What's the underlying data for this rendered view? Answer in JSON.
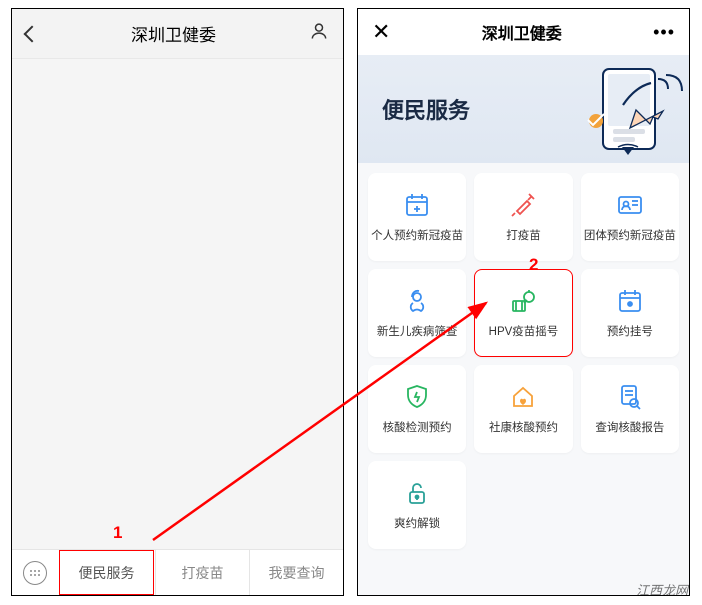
{
  "left": {
    "title": "深圳卫健委",
    "tabs": {
      "t1": "便民服务",
      "t2": "打疫苗",
      "t3": "我要查询"
    }
  },
  "right": {
    "title": "深圳卫健委",
    "banner": "便民服务",
    "cards": {
      "c0": "个人预约新冠疫苗",
      "c1": "打疫苗",
      "c2": "团体预约新冠疫苗",
      "c3": "新生儿疾病筛查",
      "c4": "HPV疫苗摇号",
      "c5": "预约挂号",
      "c6": "核酸检测预约",
      "c7": "社康核酸预约",
      "c8": "查询核酸报告",
      "c9": "爽约解锁"
    }
  },
  "annotations": {
    "a1": "1",
    "a2": "2"
  },
  "colors": {
    "blue": "#3a8ef0",
    "red": "#ef5350",
    "green": "#28b661",
    "orange": "#f7a23b",
    "teal": "#2aa198",
    "annot": "#f00"
  },
  "watermark": "江西龙网"
}
